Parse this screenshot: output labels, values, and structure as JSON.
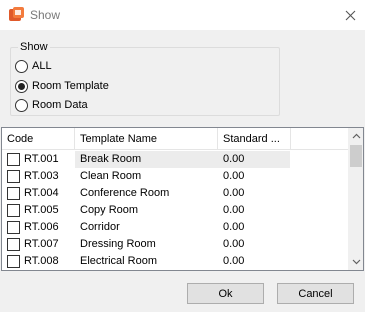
{
  "window": {
    "title": "Show",
    "app_icon": "app-icon",
    "close_icon": "close-icon"
  },
  "show_group": {
    "label": "Show",
    "options": [
      {
        "label": "ALL",
        "checked": false
      },
      {
        "label": "Room Template",
        "checked": true
      },
      {
        "label": "Room Data",
        "checked": false
      }
    ]
  },
  "table": {
    "columns": [
      "Code",
      "Template Name",
      "Standard ..."
    ],
    "rows": [
      {
        "code": "RT.001",
        "name": "Break Room",
        "standard": "0.00"
      },
      {
        "code": "RT.003",
        "name": "Clean Room",
        "standard": "0.00"
      },
      {
        "code": "RT.004",
        "name": "Conference Room",
        "standard": "0.00"
      },
      {
        "code": "RT.005",
        "name": "Copy Room",
        "standard": "0.00"
      },
      {
        "code": "RT.006",
        "name": "Corridor",
        "standard": "0.00"
      },
      {
        "code": "RT.007",
        "name": "Dressing Room",
        "standard": "0.00"
      },
      {
        "code": "RT.008",
        "name": "Electrical Room",
        "standard": "0.00"
      }
    ]
  },
  "buttons": {
    "ok": "Ok",
    "cancel": "Cancel"
  }
}
